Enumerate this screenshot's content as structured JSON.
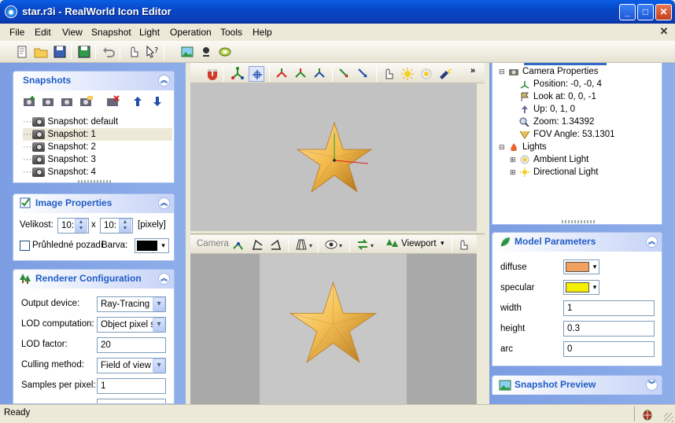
{
  "window": {
    "title": "star.r3i - RealWorld Icon Editor",
    "minimize": "_",
    "maximize": "□",
    "close": "✕"
  },
  "menu": [
    "File",
    "Edit",
    "View",
    "Snapshot",
    "Light",
    "Operation",
    "Tools",
    "Help"
  ],
  "mdi_close": "✕",
  "snapshots": {
    "title": "Snapshots",
    "items": [
      "Snapshot: default",
      "Snapshot: 1",
      "Snapshot: 2",
      "Snapshot: 3",
      "Snapshot: 4"
    ],
    "selected_index": 1
  },
  "image_properties": {
    "title": "Image Properties",
    "size_label": "Velikost:",
    "width_value": "10:",
    "x_label": "x",
    "height_value": "10:",
    "unit": "[pixely]",
    "transparent_label": "Průhledné pozadí",
    "color_label": "Barva:",
    "color_value": "#000000"
  },
  "renderer": {
    "title": "Renderer Configuration",
    "rows": [
      {
        "label": "Output device:",
        "value": "Ray-Tracing",
        "combo": true
      },
      {
        "label": "LOD computation:",
        "value": "Object pixel s",
        "combo": true
      },
      {
        "label": "LOD factor:",
        "value": "20",
        "combo": false
      },
      {
        "label": "Culling method:",
        "value": "Field of view c",
        "combo": true
      },
      {
        "label": "Samples per pixel:",
        "value": "1",
        "combo": false
      }
    ]
  },
  "viewport_toolbar": {
    "camera_label": "Camera",
    "viewport_label": "Viewport"
  },
  "scene_tree": {
    "camera": "Camera Properties",
    "camera_props": [
      "Position: -0, -0, 4",
      "Look at: 0, 0, -1",
      "Up: 0, 1, 0",
      "Zoom: 1.34392",
      "FOV Angle: 53.1301"
    ],
    "lights": "Lights",
    "light_items": [
      "Ambient Light",
      "Directional Light"
    ]
  },
  "model_parameters": {
    "title": "Model Parameters",
    "diffuse_label": "diffuse",
    "diffuse_color": "#f2a060",
    "specular_label": "specular",
    "specular_color": "#f5f000",
    "width_label": "width",
    "width_value": "1",
    "height_label": "height",
    "height_value": "0.3",
    "arc_label": "arc",
    "arc_value": "0"
  },
  "snapshot_preview": {
    "title": "Snapshot Preview"
  },
  "status": {
    "text": "Ready"
  },
  "colors": {
    "accent": "#215dc6",
    "title_bar": "#0a47c8",
    "star": "#f2b94a"
  }
}
